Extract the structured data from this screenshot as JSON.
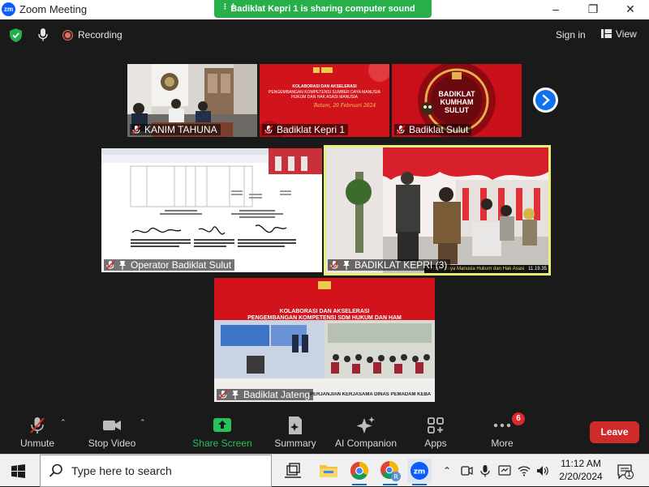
{
  "window": {
    "title": "Zoom Meeting",
    "logo_text": "zm",
    "share_banner": "Badiklat Kepri 1 is sharing computer sound",
    "controls": [
      "–",
      "❐",
      "✕"
    ]
  },
  "topbar": {
    "recording_label": "Recording",
    "signin_label": "Sign in",
    "view_label": "View"
  },
  "tiles": [
    {
      "name": "KANIM TAHUNA",
      "muted": true,
      "pinned": false
    },
    {
      "name": "Badiklat Kepri 1",
      "muted": true,
      "pinned": false
    },
    {
      "name": "Badiklat Sulut",
      "muted": true,
      "pinned": false
    },
    {
      "name": "Operator Badiklat Sulut",
      "muted": true,
      "pinned": true
    },
    {
      "name": "BADIKLAT KEPRI (3)",
      "muted": true,
      "pinned": true,
      "active_speaker": true
    },
    {
      "name": "Badiklat Jateng",
      "muted": true,
      "pinned": true
    }
  ],
  "slides": {
    "kepri_title": "KOLABORASI DAN AKSELERASI",
    "kepri_subtitle": "PENGEMBANGAN KOMPETENSI SUMBER DAYA MANUSIA HUKUM DAN HAK ASASI MANUSIA",
    "kepri_script": "Batam, 20 Februari 2024",
    "sulut_line1": "BADIKLAT",
    "sulut_line2": "KUMHAM",
    "sulut_line3": "SULUT",
    "jateng_title": "KOLABORASI DAN AKSELERASI",
    "jateng_subtitle": "PENGEMBANGAN KOMPETENSI SDM HUKUM DAN HAM",
    "jateng_caption": "PERJANJIAN KERJASAMA DINAS PEMADAM KEBA",
    "kepri3_ticker": "Sumber Daya Manusia Hukum dan Hak Asasi",
    "kepri3_time": "11.19.35"
  },
  "toolbar": {
    "unmute": "Unmute",
    "stop_video": "Stop Video",
    "share_screen": "Share Screen",
    "summary": "Summary",
    "ai_companion": "AI Companion",
    "apps": "Apps",
    "more": "More",
    "more_badge": "6",
    "leave": "Leave"
  },
  "taskbar": {
    "search_placeholder": "Type here to search",
    "time": "11:12 AM",
    "date": "2/20/2024",
    "notification_count": "1"
  },
  "colors": {
    "share_green": "#27b04a",
    "leave_red": "#d02b2b",
    "zoom_blue": "#0b5cff",
    "active_speaker_border": "#e8f07a"
  }
}
